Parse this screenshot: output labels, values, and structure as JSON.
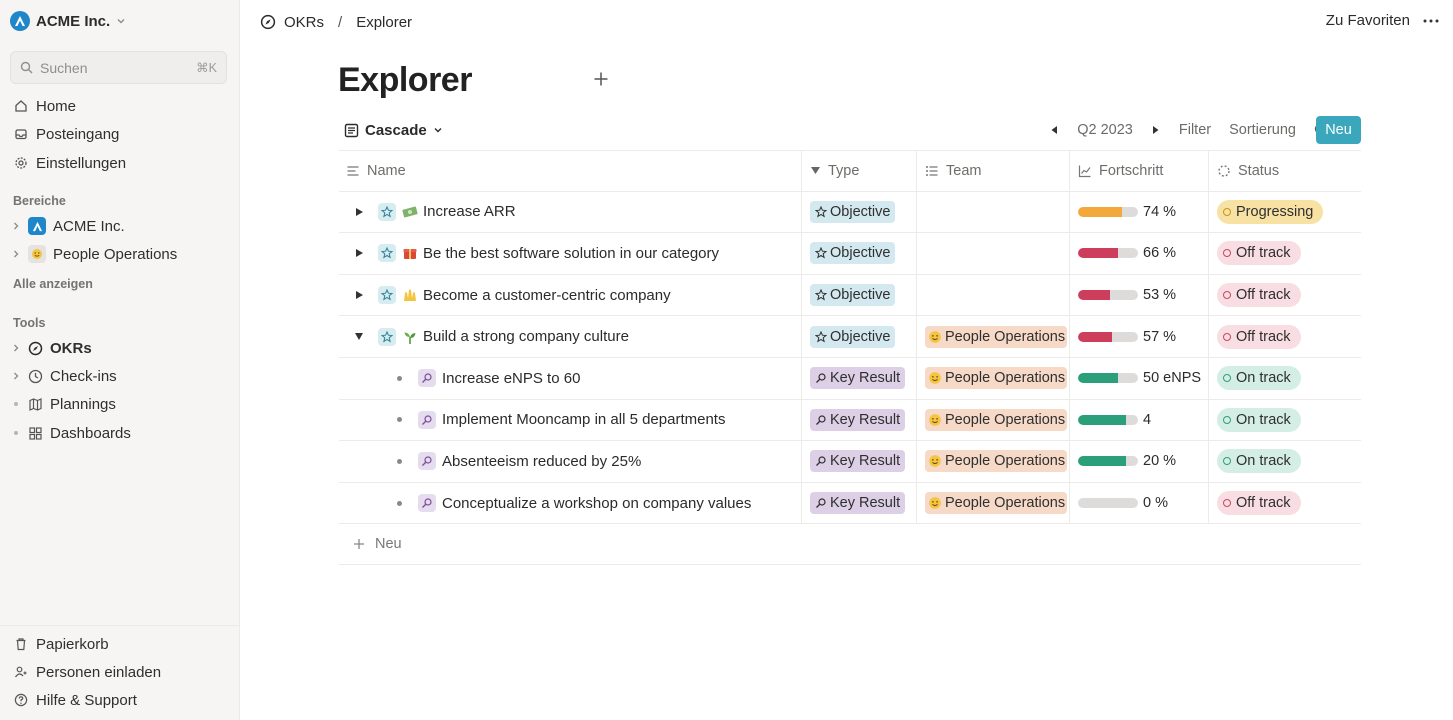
{
  "sidebar": {
    "workspace": "ACME Inc.",
    "search_placeholder": "Suchen",
    "search_shortcut": "⌘K",
    "nav": [
      {
        "label": "Home",
        "icon": "home-icon"
      },
      {
        "label": "Posteingang",
        "icon": "inbox-icon"
      },
      {
        "label": "Einstellungen",
        "icon": "gear-icon"
      }
    ],
    "areas_title": "Bereiche",
    "areas": [
      {
        "label": "ACME Inc.",
        "icon": "acme-logo-icon"
      },
      {
        "label": "People Operations",
        "icon": "smile-emoji-icon"
      }
    ],
    "show_all": "Alle anzeigen",
    "tools_title": "Tools",
    "tools": [
      {
        "label": "OKRs",
        "icon": "compass-icon"
      },
      {
        "label": "Check-ins",
        "icon": "clock-icon"
      },
      {
        "label": "Plannings",
        "icon": "map-icon"
      },
      {
        "label": "Dashboards",
        "icon": "grid-icon"
      }
    ],
    "bottom": [
      {
        "label": "Papierkorb",
        "icon": "trash-icon"
      },
      {
        "label": "Personen einladen",
        "icon": "invite-icon"
      },
      {
        "label": "Hilfe & Support",
        "icon": "help-icon"
      }
    ]
  },
  "topbar": {
    "breadcrumb": [
      "OKRs",
      "Explorer"
    ],
    "favorite": "Zu Favoriten"
  },
  "page": {
    "title": "Explorer",
    "view": "Cascade",
    "period": "Q2 2023",
    "filter": "Filter",
    "sort": "Sortierung",
    "new_button": "Neu"
  },
  "table": {
    "columns": {
      "name": "Name",
      "type": "Type",
      "team": "Team",
      "progress": "Fortschritt",
      "status": "Status"
    },
    "rows": [
      {
        "name": "Increase ARR",
        "emoji": "money",
        "type": "Objective",
        "team": "",
        "progress": 0.74,
        "progress_text": "74 %",
        "status": "Progressing"
      },
      {
        "name": "Be the best software solution in our category",
        "emoji": "gift",
        "type": "Objective",
        "team": "",
        "progress": 0.66,
        "progress_text": "66 %",
        "status": "Off track"
      },
      {
        "name": "Become a customer-centric company",
        "emoji": "raised-hands",
        "type": "Objective",
        "team": "",
        "progress": 0.53,
        "progress_text": "53 %",
        "status": "Off track"
      },
      {
        "name": "Build a strong company culture",
        "emoji": "seedling",
        "type": "Objective",
        "team": "People Operations",
        "progress": 0.57,
        "progress_text": "57 %",
        "status": "Off track"
      },
      {
        "name": "Increase eNPS to 60",
        "type": "Key Result",
        "team": "People Operations",
        "progress": 0.66,
        "progress_text": "50 eNPS",
        "status": "On track"
      },
      {
        "name": "Implement Mooncamp in all 5 departments",
        "type": "Key Result",
        "team": "People Operations",
        "progress": 0.8,
        "progress_text": "4",
        "status": "On track"
      },
      {
        "name": "Absenteeism reduced by 25%",
        "type": "Key Result",
        "team": "People Operations",
        "progress": 0.8,
        "progress_text": "20 %",
        "status": "On track"
      },
      {
        "name": "Conceptualize a workshop on company values",
        "type": "Key Result",
        "team": "People Operations",
        "progress": 0,
        "progress_text": "0 %",
        "status": "Off track"
      }
    ],
    "new_row": "Neu"
  },
  "colors": {
    "accent": "#3aa7bd",
    "progress_orange": "#f4a73a",
    "progress_red": "#cc3e5c",
    "progress_green": "#2a9f7a"
  }
}
